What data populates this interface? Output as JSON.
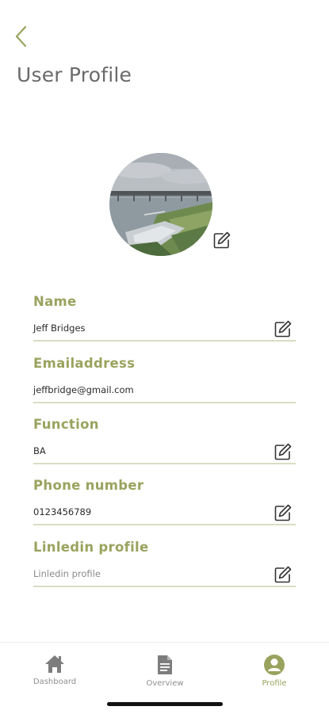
{
  "header": {
    "back_icon": "chevron-left-icon",
    "title": "User Profile"
  },
  "avatar": {
    "description_icon": "edit-pencil-icon"
  },
  "fields": [
    {
      "label": "Name",
      "value": "Jeff Bridges",
      "editable": true
    },
    {
      "label": "Emailaddress",
      "value": "jeffbridge@gmail.com",
      "editable": false
    },
    {
      "label": "Function",
      "value": "BA",
      "editable": true
    },
    {
      "label": "Phone number",
      "value": "0123456789",
      "editable": true
    },
    {
      "label": "Linledin profile",
      "value": "Linledin profile",
      "editable": true,
      "is_placeholder": true
    }
  ],
  "tabbar": {
    "tabs": [
      {
        "label": "Dashboard",
        "icon": "home-icon",
        "active": false
      },
      {
        "label": "Overview",
        "icon": "document-icon",
        "active": false
      },
      {
        "label": "Profile",
        "icon": "user-circle-icon",
        "active": true
      }
    ]
  },
  "colors": {
    "accent": "#9aa35e",
    "divider": "#d9dcc4",
    "title": "#6a6a6a",
    "tab_inactive": "#8f8f8f"
  }
}
